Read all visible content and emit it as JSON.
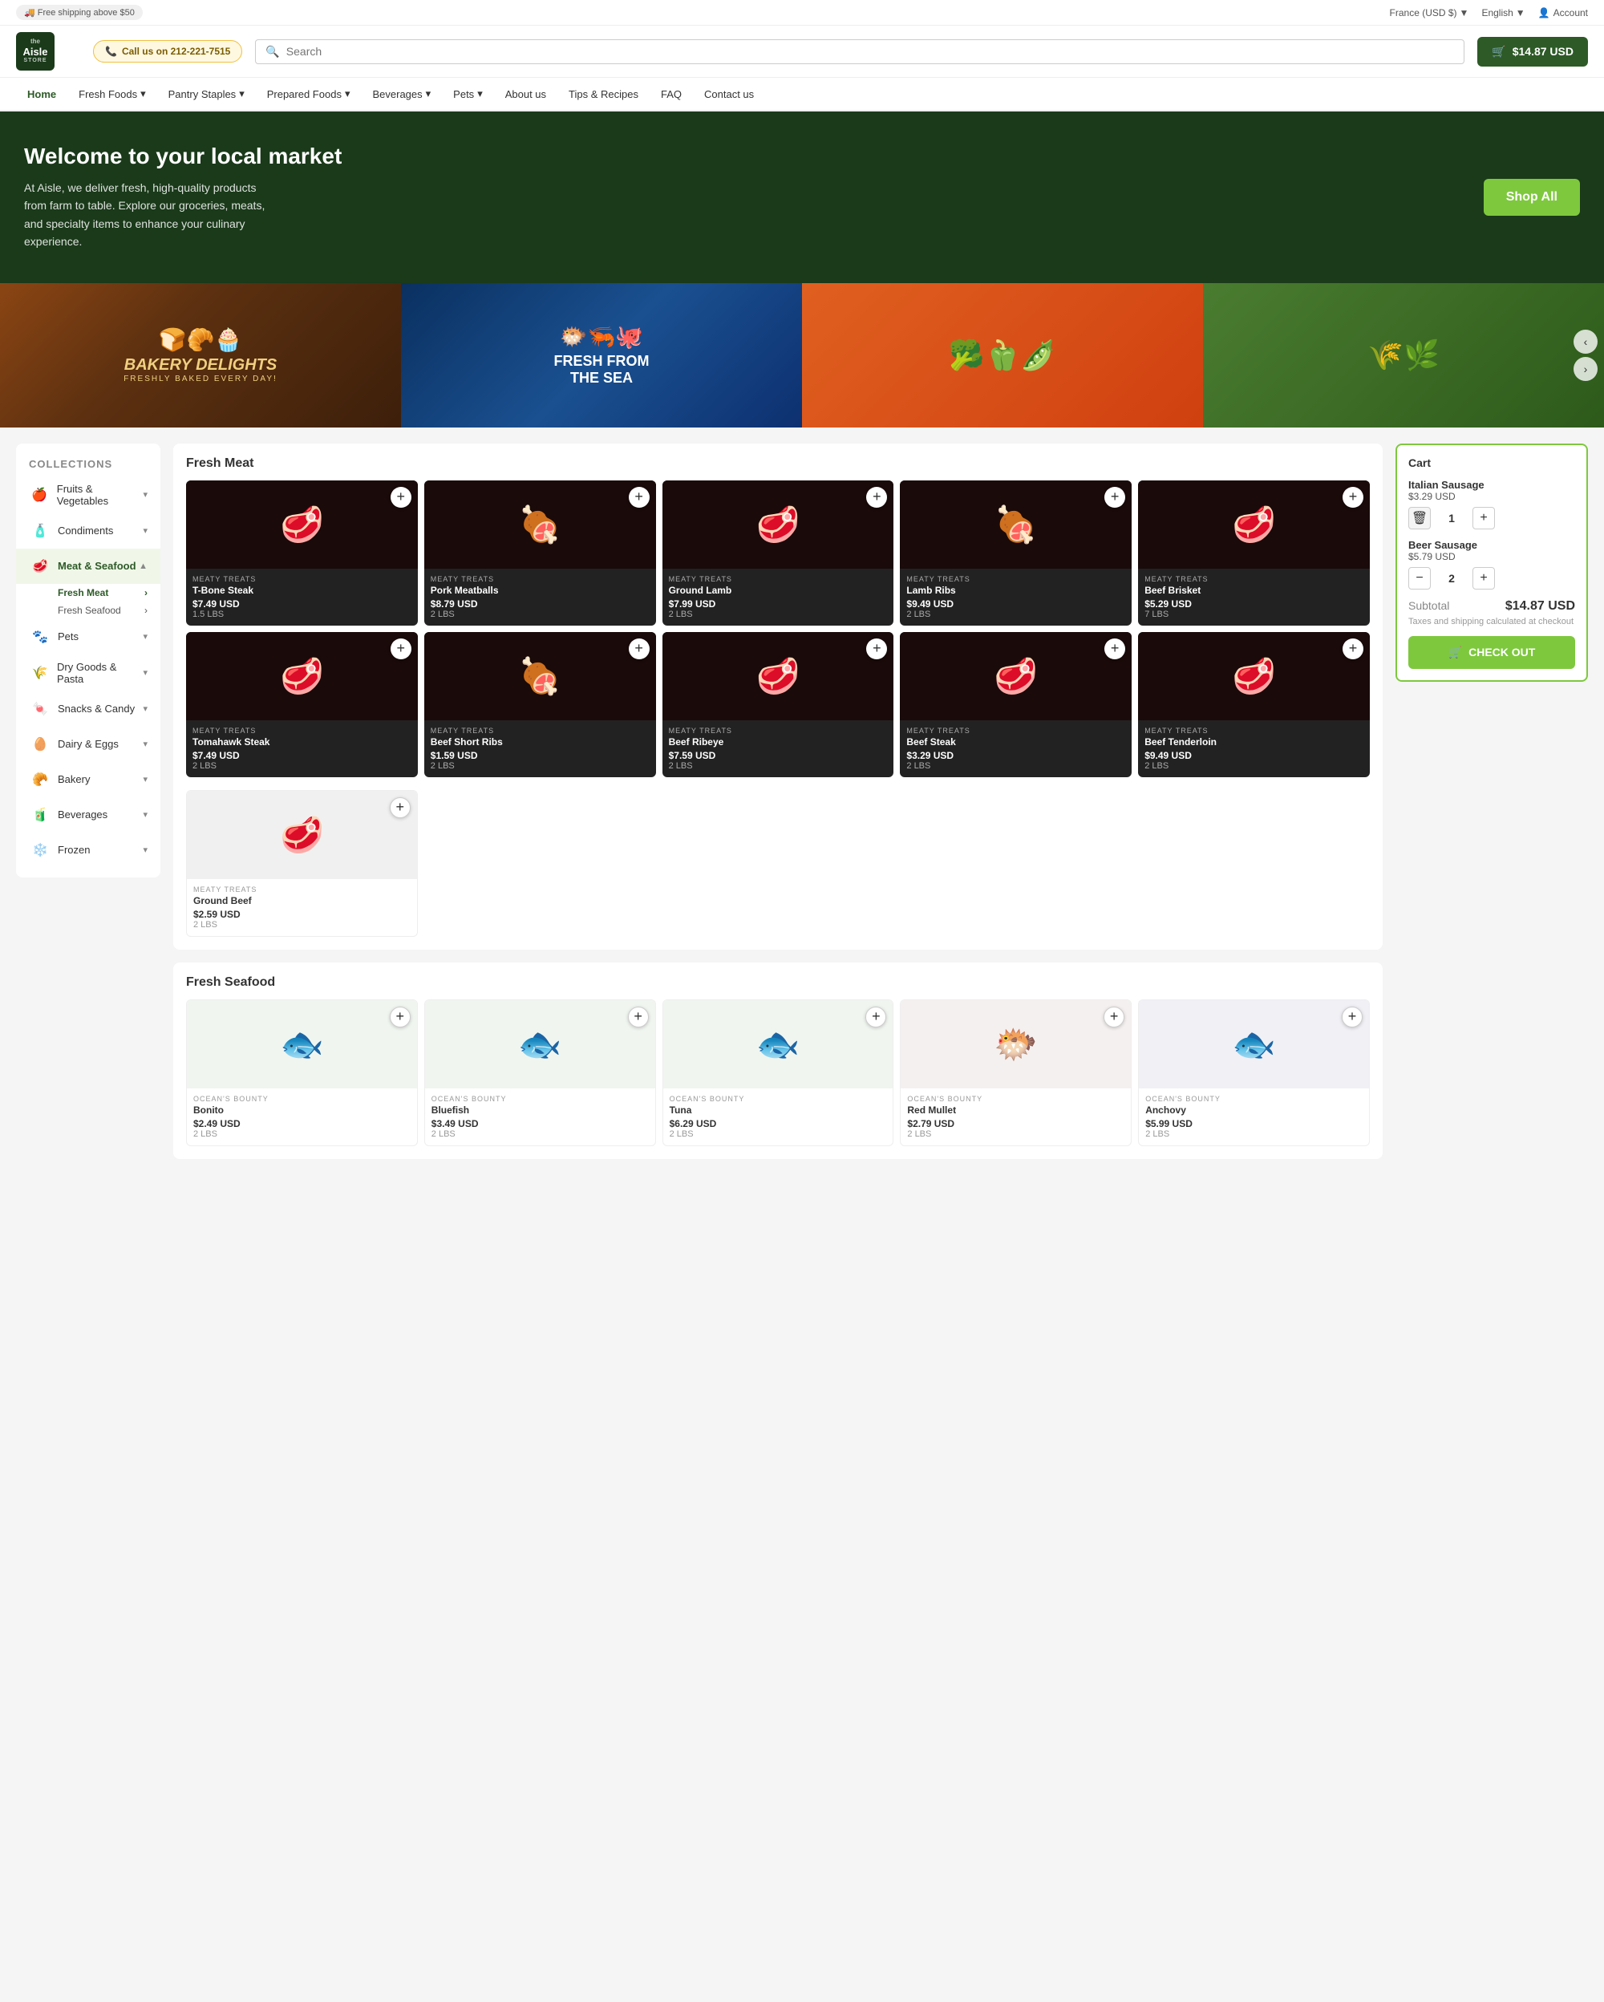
{
  "topbar": {
    "shipping_badge": "🚚 Free shipping above $50",
    "currency": "France (USD $)",
    "language": "English",
    "account": "Account",
    "currency_icon": "▼",
    "lang_icon": "▼",
    "account_icon": "👤"
  },
  "header": {
    "logo_line1": "the",
    "logo_line2": "Aisle",
    "logo_line3": "STORE",
    "call_us": "Call us on 212-221-7515",
    "search_placeholder": "Search",
    "cart_total": "$14.87 USD",
    "cart_icon": "🛒"
  },
  "nav": {
    "items": [
      {
        "label": "Home",
        "active": true
      },
      {
        "label": "Fresh Foods",
        "has_dropdown": true
      },
      {
        "label": "Pantry Staples",
        "has_dropdown": true
      },
      {
        "label": "Prepared Foods",
        "has_dropdown": true
      },
      {
        "label": "Beverages",
        "has_dropdown": true
      },
      {
        "label": "Pets",
        "has_dropdown": true
      },
      {
        "label": "About us"
      },
      {
        "label": "Tips & Recipes"
      },
      {
        "label": "FAQ"
      },
      {
        "label": "Contact us"
      }
    ]
  },
  "hero": {
    "title": "Welcome to your local market",
    "description": "At Aisle, we deliver fresh, high-quality products from farm to table. Explore our groceries, meats, and specialty items to enhance your culinary experience.",
    "shop_all": "Shop All"
  },
  "banners": [
    {
      "type": "bakery",
      "title": "BAKERY DELIGHTS",
      "subtitle": "FRESHLY BAKED EVERY DAY!",
      "icon": "🍞"
    },
    {
      "type": "sea",
      "title": "FRESH FROM THE SEA",
      "subtitle": "",
      "icon": "🐟"
    },
    {
      "type": "veggies",
      "icon": "🥦"
    },
    {
      "type": "fields",
      "icon": "🌾"
    }
  ],
  "sidebar": {
    "title": "Collections",
    "categories": [
      {
        "label": "Fruits & Vegetables",
        "icon": "🍎",
        "has_sub": true,
        "active": false
      },
      {
        "label": "Condiments",
        "icon": "🧴",
        "has_sub": true,
        "active": false
      },
      {
        "label": "Meat & Seafood",
        "icon": "🥩",
        "has_sub": true,
        "active": true,
        "subs": [
          {
            "label": "Fresh Meat",
            "active": true
          },
          {
            "label": "Fresh Seafood",
            "active": false
          }
        ]
      },
      {
        "label": "Pets",
        "icon": "🐾",
        "has_sub": true,
        "active": false
      },
      {
        "label": "Dry Goods & Pasta",
        "icon": "🌾",
        "has_sub": true,
        "active": false
      },
      {
        "label": "Snacks & Candy",
        "icon": "🍬",
        "has_sub": true,
        "active": false
      },
      {
        "label": "Dairy & Eggs",
        "icon": "🥚",
        "has_sub": true,
        "active": false
      },
      {
        "label": "Bakery",
        "icon": "🥐",
        "has_sub": true,
        "active": false
      },
      {
        "label": "Beverages",
        "icon": "🧃",
        "has_sub": true,
        "active": false
      },
      {
        "label": "Frozen",
        "icon": "❄️",
        "has_sub": true,
        "active": false
      }
    ]
  },
  "cart": {
    "title": "Cart",
    "items": [
      {
        "name": "Italian Sausage",
        "price": "$3.29 USD",
        "qty": 1
      },
      {
        "name": "Beer Sausage",
        "price": "$5.79 USD",
        "qty": 2
      }
    ],
    "subtotal_label": "Subtotal",
    "subtotal": "$14.87 USD",
    "tax_note": "Taxes and shipping calculated at checkout",
    "checkout_label": "CHECK OUT",
    "checkout_icon": "🛒"
  },
  "fresh_meat": {
    "section_title": "Fresh Meat",
    "products": [
      {
        "brand": "MEATY TREATS",
        "name": "T-Bone Steak",
        "price": "$7.49 USD",
        "weight": "1.5 LBS",
        "emoji": "🥩"
      },
      {
        "brand": "MEATY TREATS",
        "name": "Pork Meatballs",
        "price": "$8.79 USD",
        "weight": "2 LBS",
        "emoji": "🍖"
      },
      {
        "brand": "MEATY TREATS",
        "name": "Ground Lamb",
        "price": "$7.99 USD",
        "weight": "2 LBS",
        "emoji": "🥩"
      },
      {
        "brand": "MEATY TREATS",
        "name": "Lamb Ribs",
        "price": "$9.49 USD",
        "weight": "2 LBS",
        "emoji": "🍖"
      },
      {
        "brand": "MEATY TREATS",
        "name": "Beef Brisket",
        "price": "$5.29 USD",
        "weight": "7 LBS",
        "emoji": "🥩"
      },
      {
        "brand": "MEATY TREATS",
        "name": "Tomahawk Steak",
        "price": "$7.49 USD",
        "weight": "2 LBS",
        "emoji": "🥩"
      },
      {
        "brand": "MEATY TREATS",
        "name": "Beef Short Ribs",
        "price": "$1.59 USD",
        "weight": "2 LBS",
        "emoji": "🍖"
      },
      {
        "brand": "MEATY TREATS",
        "name": "Beef Ribeye",
        "price": "$7.59 USD",
        "weight": "2 LBS",
        "emoji": "🥩"
      },
      {
        "brand": "MEATY TREATS",
        "name": "Beef Steak",
        "price": "$3.29 USD",
        "weight": "2 LBS",
        "emoji": "🥩"
      },
      {
        "brand": "MEATY TREATS",
        "name": "Beef Tenderloin",
        "price": "$9.49 USD",
        "weight": "2 LBS",
        "emoji": "🥩"
      },
      {
        "brand": "MEATY TREATS",
        "name": "Ground Beef",
        "price": "$2.59 USD",
        "weight": "2 LBS",
        "emoji": "🥩"
      }
    ]
  },
  "fresh_seafood": {
    "section_title": "Fresh Seafood",
    "products": [
      {
        "brand": "OCEAN'S BOUNTY",
        "name": "Bonito",
        "price": "$2.49 USD",
        "weight": "2 LBS",
        "emoji": "🐟"
      },
      {
        "brand": "OCEAN'S BOUNTY",
        "name": "Bluefish",
        "price": "$3.49 USD",
        "weight": "2 LBS",
        "emoji": "🐟"
      },
      {
        "brand": "OCEAN'S BOUNTY",
        "name": "Tuna",
        "price": "$6.29 USD",
        "weight": "2 LBS",
        "emoji": "🐟"
      },
      {
        "brand": "OCEAN'S BOUNTY",
        "name": "Red Mullet",
        "price": "$2.79 USD",
        "weight": "2 LBS",
        "emoji": "🐟"
      },
      {
        "brand": "OCEAN'S BOUNTY",
        "name": "Anchovy",
        "price": "$5.99 USD",
        "weight": "2 LBS",
        "emoji": "🐟"
      }
    ]
  }
}
